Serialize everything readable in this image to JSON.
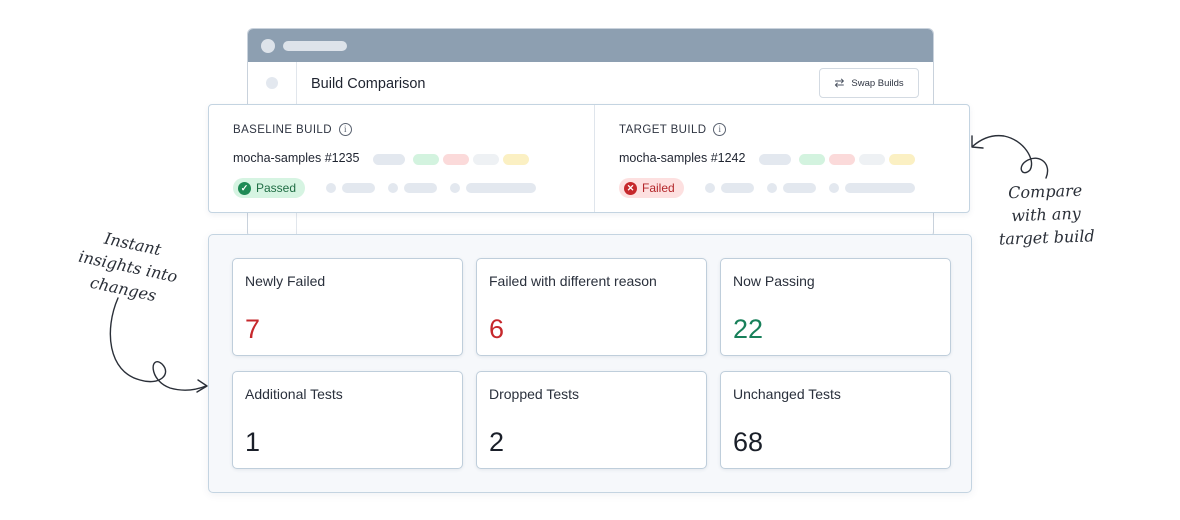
{
  "window": {
    "title": "Build Comparison",
    "swap_label": "Swap Builds",
    "icons": {
      "swap": "swap-arrows-icon",
      "filter": "filter-icon"
    }
  },
  "baseline": {
    "heading": "BASELINE BUILD",
    "build_name": "mocha-samples #1235",
    "status": "Passed",
    "status_color": "#1f6d44"
  },
  "target": {
    "heading": "TARGET BUILD",
    "build_name": "mocha-samples #1242",
    "status": "Failed",
    "status_color": "#b3262a"
  },
  "metrics": [
    {
      "label": "Newly Failed",
      "value": "7",
      "color": "#c6282c"
    },
    {
      "label": "Failed with different reason",
      "value": "6",
      "color": "#c6282c"
    },
    {
      "label": "Now Passing",
      "value": "22",
      "color": "#18805a"
    },
    {
      "label": "Additional Tests",
      "value": "1",
      "color": "#1a1f29"
    },
    {
      "label": "Dropped Tests",
      "value": "2",
      "color": "#1a1f29"
    },
    {
      "label": "Unchanged Tests",
      "value": "68",
      "color": "#1a1f29"
    }
  ],
  "annotations": {
    "left": [
      "Instant",
      "insights into",
      "changes"
    ],
    "right": [
      "Compare",
      "with any",
      "target build"
    ]
  }
}
